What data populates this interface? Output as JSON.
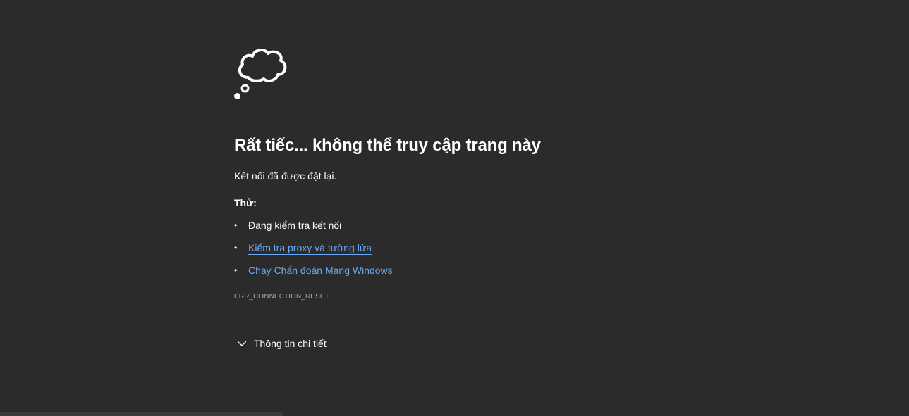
{
  "colors": {
    "background": "#2b2b2b",
    "text": "#ffffff",
    "link": "#69a9f1",
    "muted": "#a6a6a6"
  },
  "icon": "thought-cloud-icon",
  "error_page": {
    "title": "Rất tiếc... không thể truy cập trang này",
    "subtitle": "Kết nối đã được đặt lại.",
    "try_label": "Thử:",
    "suggestions": [
      {
        "text": "Đang kiểm tra kết nối",
        "is_link": false
      },
      {
        "text": "Kiểm tra proxy và tường lửa",
        "is_link": true
      },
      {
        "text": "Chạy Chẩn đoán Mạng Windows",
        "is_link": true
      }
    ],
    "error_code": "ERR_CONNECTION_RESET",
    "details_label": "Thông tin chi tiết"
  }
}
